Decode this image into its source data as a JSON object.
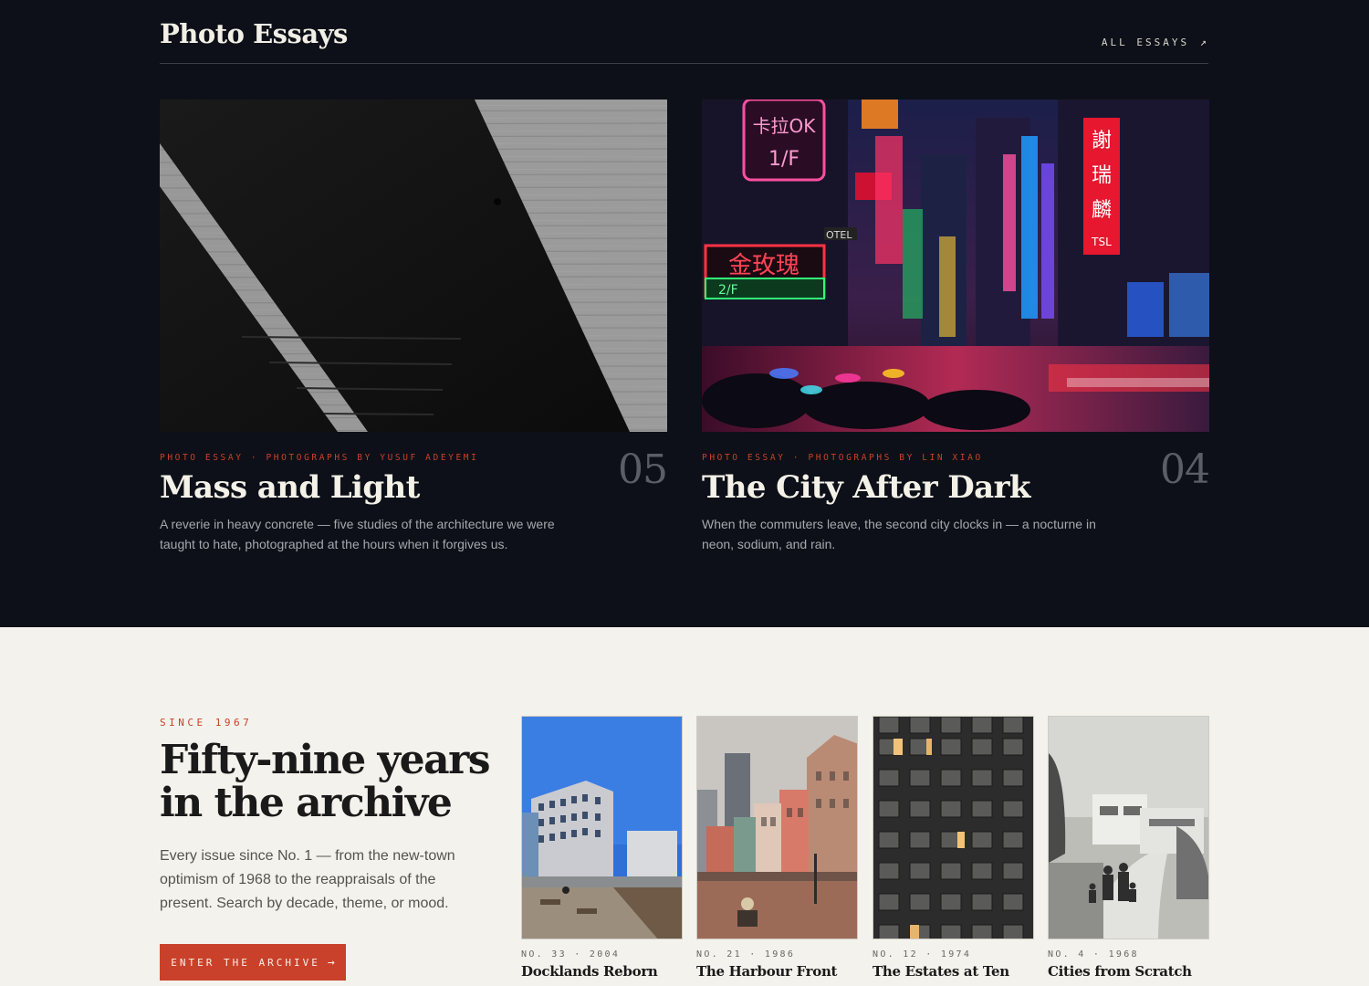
{
  "header": {
    "title": "Photo Essays",
    "all_essays_label": "ALL ESSAYS",
    "all_essays_arrow": "↗"
  },
  "essays": [
    {
      "kicker": "PHOTO ESSAY · PHOTOGRAPHS BY YUSUF ADEYEMI",
      "number": "05",
      "title": "Mass and Light",
      "description": "A reverie in heavy concrete — five studies of the architecture we were taught to hate, photographed at the hours when it forgives us.",
      "image": "concrete-stair-shadow-bw"
    },
    {
      "kicker": "PHOTO ESSAY · PHOTOGRAPHS BY LIN XIAO",
      "number": "04",
      "title": "The City After Dark",
      "description": "When the commuters leave, the second city clocks in — a nocturne in neon, sodium, and rain.",
      "image": "neon-street-night",
      "sign_texts": [
        "卡拉OK",
        "1/F",
        "金玫瑰",
        "2/F",
        "謝",
        "瑞",
        "麟",
        "TSL",
        "OTEL"
      ]
    }
  ],
  "archive": {
    "since": "SINCE 1967",
    "title": "Fifty-nine years in the archive",
    "description": "Every issue since No. 1 — from the new-town optimism of 1968 to the reappraisals of the present. Search by decade, theme, or mood.",
    "button_label": "ENTER THE ARCHIVE",
    "button_arrow": "→"
  },
  "issues": [
    {
      "meta": "NO. 33 · 2004",
      "title": "Docklands Reborn",
      "image": "waterfront-apartments"
    },
    {
      "meta": "NO. 21 · 1986",
      "title": "The Harbour Front",
      "image": "colorful-harbour-buildings"
    },
    {
      "meta": "NO. 12 · 1974",
      "title": "The Estates at Ten",
      "image": "tower-block-windows"
    },
    {
      "meta": "NO. 4 · 1968",
      "title": "Cities from Scratch",
      "image": "family-walking-bw"
    }
  ],
  "colors": {
    "dark_bg": "#0d1018",
    "light_bg": "#f4f2ec",
    "accent": "#c9412a"
  }
}
